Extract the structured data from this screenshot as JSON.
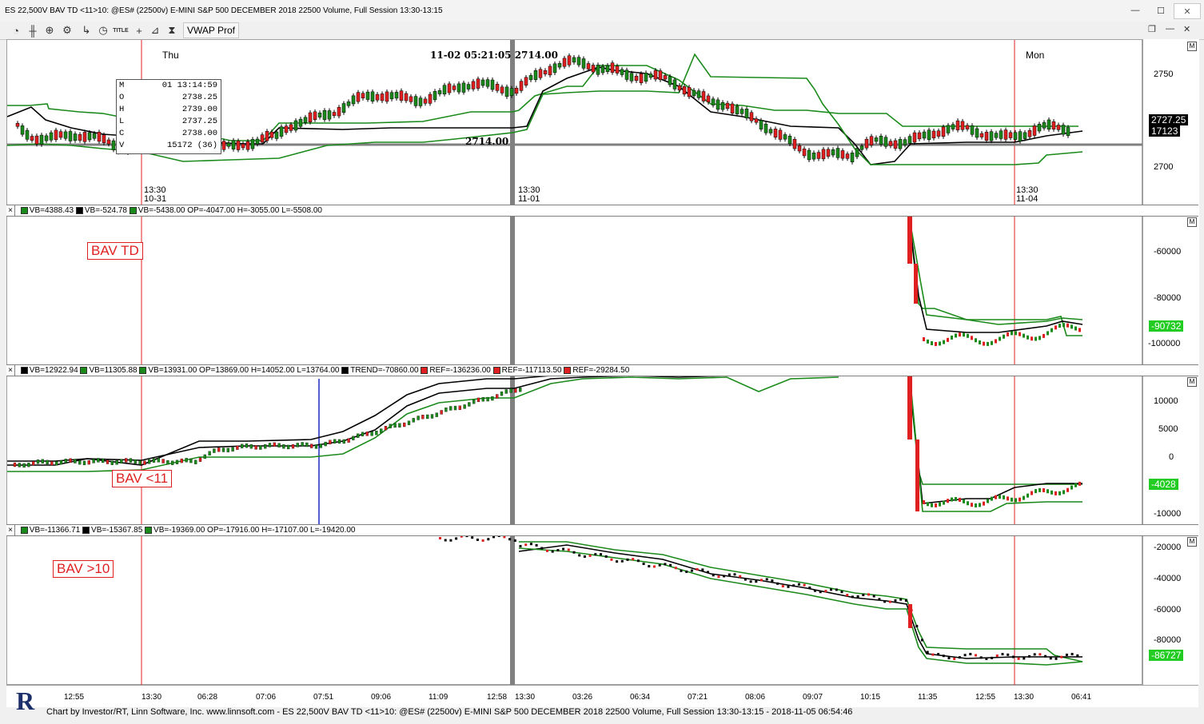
{
  "window": {
    "title": "ES 22,500V BAV TD <11>10: @ES# (22500v) E-MINI S&P 500 DECEMBER 2018 22500 Volume, Full Session 13:30-13:15",
    "minimize": "—",
    "maximize": "☐",
    "close": "✕"
  },
  "toolbar": {
    "vwap_label": "VWAP Prof",
    "icons": [
      "pie-icon",
      "bars-icon",
      "zoom-icon",
      "gear-icon",
      "clock-icon",
      "title-icon",
      "crosshair-icon",
      "draw-icon",
      "hourglass-icon"
    ],
    "right_icons": [
      "restore-icon",
      "minimize-icon",
      "close-icon"
    ]
  },
  "price_pane": {
    "day_labels": [
      "Thu",
      "Mon"
    ],
    "timestamp": "11-02 05:21:05 2714.00",
    "mid_price": "2714.00",
    "axis_ticks": [
      "2750",
      "2700"
    ],
    "last_price": "2727.25",
    "last_volume": "17123",
    "date_marks": [
      {
        "time": "13:30",
        "date": "10-31"
      },
      {
        "time": "13:30",
        "date": "11-01"
      },
      {
        "time": "13:30",
        "date": "11-04"
      }
    ],
    "ohlc": [
      {
        "k": "M",
        "v": "01 13:14:59"
      },
      {
        "k": "O",
        "v": "2738.25"
      },
      {
        "k": "H",
        "v": "2739.00"
      },
      {
        "k": "L",
        "v": "2737.25"
      },
      {
        "k": "C",
        "v": "2738.00"
      },
      {
        "k": "V",
        "v": "15172 (36)"
      }
    ]
  },
  "pane2": {
    "header": [
      "VB=4388.43",
      "VB=-524.78",
      "VB=-5438.00 OP=-4047.00 H=-3055.00 L=-5508.00"
    ],
    "label": "BAV TD",
    "axis_ticks": [
      "-60000",
      "-80000",
      "-100000"
    ],
    "last_value": "-90732"
  },
  "pane3": {
    "header": [
      "VB=12922.94",
      "VB=11305.88",
      "VB=13931.00 OP=13869.00 H=14052.00 L=13764.00",
      "TREND=-70860.00",
      "REF=-136236.00",
      "REF=-117113.50",
      "REF=-29284.50"
    ],
    "label": "BAV <11",
    "axis_ticks": [
      "10000",
      "5000",
      "0",
      "-10000"
    ],
    "last_value": "-4028"
  },
  "pane4": {
    "header": [
      "VB=-11366.71",
      "VB=-15367.85",
      "VB=-19369.00 OP=-17916.00 H=-17107.00 L=-19420.00"
    ],
    "label": "BAV >10",
    "axis_ticks": [
      "-20000",
      "-40000",
      "-60000",
      "-80000"
    ],
    "last_value": "-86727"
  },
  "bottom_axis": {
    "ticks": [
      "12:55",
      "13:30",
      "06:28",
      "07:06",
      "07:51",
      "09:06",
      "11:09",
      "12:58",
      "13:30",
      "03:26",
      "06:34",
      "07:21",
      "08:06",
      "09:07",
      "10:15",
      "11:35",
      "12:55",
      "13:30",
      "06:41"
    ]
  },
  "footer": {
    "text": "Chart by Investor/RT, Linn Software, Inc. www.linnsoft.com - ES 22,500V BAV TD <11>10: @ES# (22500v) E-MINI S&P 500 DECEMBER 2018 22500 Volume, Full Session 13:30-13:15 - 2018-11-05 06:54:46",
    "logo_letter": "R"
  },
  "colors": {
    "green": "#1a8a1a",
    "red": "#e02020",
    "black": "#000000",
    "blue": "#1f2bbf",
    "tag_green": "#22cc22"
  }
}
